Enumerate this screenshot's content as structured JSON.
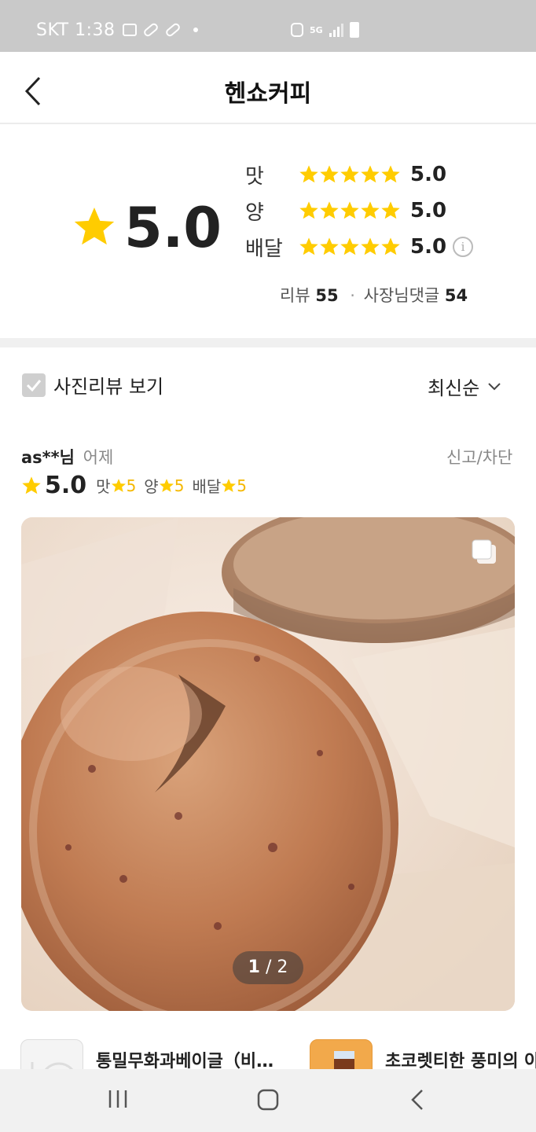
{
  "status_bar": {
    "carrier_time": "SKT 1:38",
    "network": "5G"
  },
  "header": {
    "title": "헨쇼커피"
  },
  "summary": {
    "overall_score": "5.0",
    "overall_rating": 5,
    "categories": [
      {
        "label": "맛",
        "value": "5.0",
        "stars": 5
      },
      {
        "label": "양",
        "value": "5.0",
        "stars": 5
      },
      {
        "label": "배달",
        "value": "5.0",
        "stars": 5
      }
    ],
    "info_icon": "i",
    "review_label": "리뷰",
    "review_count": "55",
    "separator": "·",
    "reply_label": "사장님댓글",
    "reply_count": "54"
  },
  "filter": {
    "photo_review_label": "사진리뷰 보기",
    "checked": true,
    "sort_label": "최신순"
  },
  "review": {
    "user": "as**님",
    "when": "어제",
    "report_label": "신고/차단",
    "score": "5.0",
    "taste_label": "맛",
    "taste_value": "5",
    "amount_label": "양",
    "amount_value": "5",
    "delivery_label": "배달",
    "delivery_value": "5",
    "pager_current": "1",
    "pager_sep": " / ",
    "pager_total": "2"
  },
  "menu_items": [
    {
      "name": "통밀무화과베이글（비…"
    },
    {
      "name": "초코렛티한 풍미의 아"
    }
  ],
  "colors": {
    "star": "#FFCC00",
    "accent": "#F5B800",
    "status_bar": "#C9C9C9"
  },
  "icons": [
    "back-arrow-icon",
    "star-icon",
    "info-icon",
    "check-icon",
    "chevron-down-icon",
    "multi-photo-icon",
    "recent-apps-icon",
    "home-icon",
    "back-icon"
  ]
}
